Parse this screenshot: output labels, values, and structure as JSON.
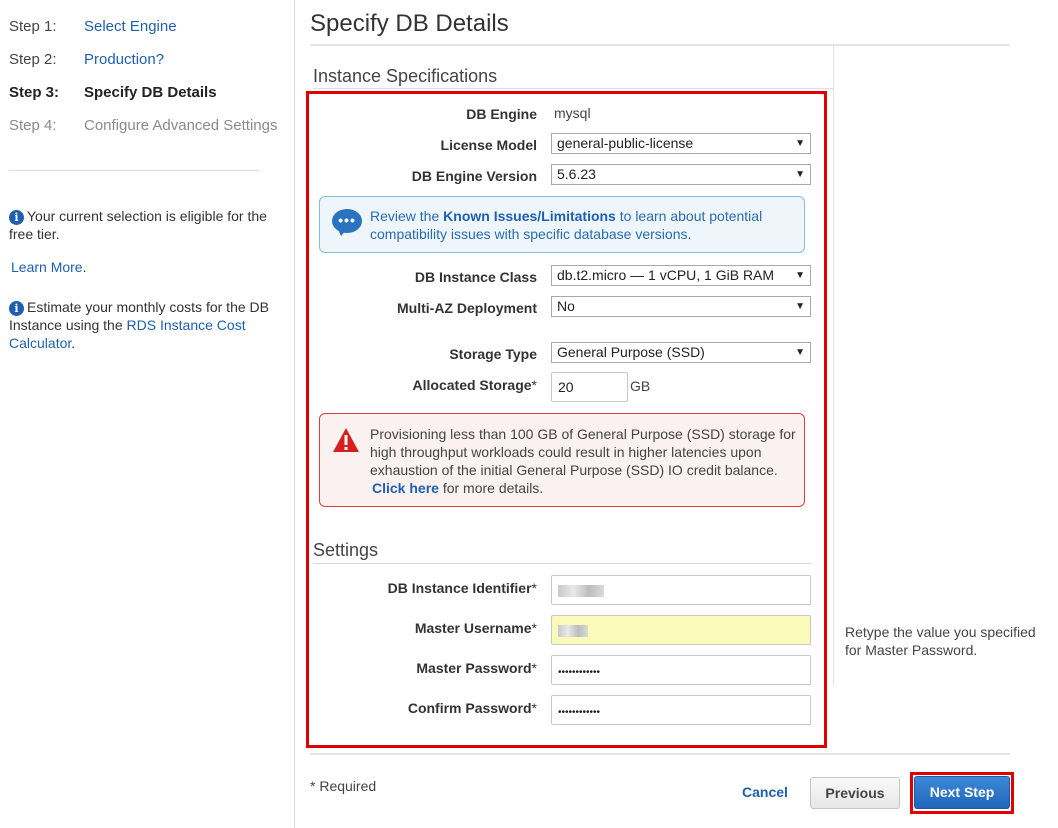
{
  "sidebar": {
    "steps": [
      {
        "num": "Step 1:",
        "label": "Select Engine"
      },
      {
        "num": "Step 2:",
        "label": "Production?"
      },
      {
        "num": "Step 3:",
        "label": "Specify DB Details"
      },
      {
        "num": "Step 4:",
        "label": "Configure Advanced Settings"
      }
    ],
    "info1": {
      "text": "Your current selection is eligible for the free tier.",
      "learn_more": "Learn More",
      "period": "."
    },
    "info2": {
      "text": "Estimate your monthly costs for the DB Instance using the",
      "link": "RDS Instance Cost Calculator",
      "period": "."
    }
  },
  "main": {
    "title": "Specify DB Details",
    "section1": "Instance Specifications",
    "section2": "Settings",
    "fields": {
      "db_engine": {
        "label": "DB Engine",
        "value": "mysql"
      },
      "license_model": {
        "label": "License Model",
        "value": "general-public-license"
      },
      "engine_version": {
        "label": "DB Engine Version",
        "value": "5.6.23"
      },
      "instance_class": {
        "label": "DB Instance Class",
        "value": "db.t2.micro — 1 vCPU, 1 GiB RAM"
      },
      "multi_az": {
        "label": "Multi-AZ Deployment",
        "value": "No"
      },
      "storage_type": {
        "label": "Storage Type",
        "value": "General Purpose (SSD)"
      },
      "allocated_storage": {
        "label": "Allocated Storage",
        "value": "20",
        "unit": "GB"
      },
      "instance_identifier": {
        "label": "DB Instance Identifier"
      },
      "master_username": {
        "label": "Master Username"
      },
      "master_password": {
        "label": "Master Password",
        "value": "••••••••••••"
      },
      "confirm_password": {
        "label": "Confirm Password",
        "value": "••••••••••••"
      }
    },
    "required_mark": "*",
    "info_callout": {
      "pre": "Review the",
      "link": "Known Issues/Limitations",
      "post": "to learn about potential compatibility issues with specific database versions."
    },
    "warning_callout": {
      "text": "Provisioning less than 100 GB of General Purpose (SSD) storage for high throughput workloads could result in higher latencies upon exhaustion of the initial General Purpose (SSD) IO credit balance.",
      "link": "Click here",
      "post": "for more details."
    },
    "help_text": "Retype the value you specified for Master Password.",
    "required_note": "* Required"
  },
  "buttons": {
    "cancel": "Cancel",
    "previous": "Previous",
    "next": "Next Step"
  },
  "colors": {
    "link": "#1f5fb0",
    "highlight": "#e00000",
    "primary_button": "#2a73c0",
    "warning_border": "#d84040",
    "info_border": "#80bfe0"
  }
}
